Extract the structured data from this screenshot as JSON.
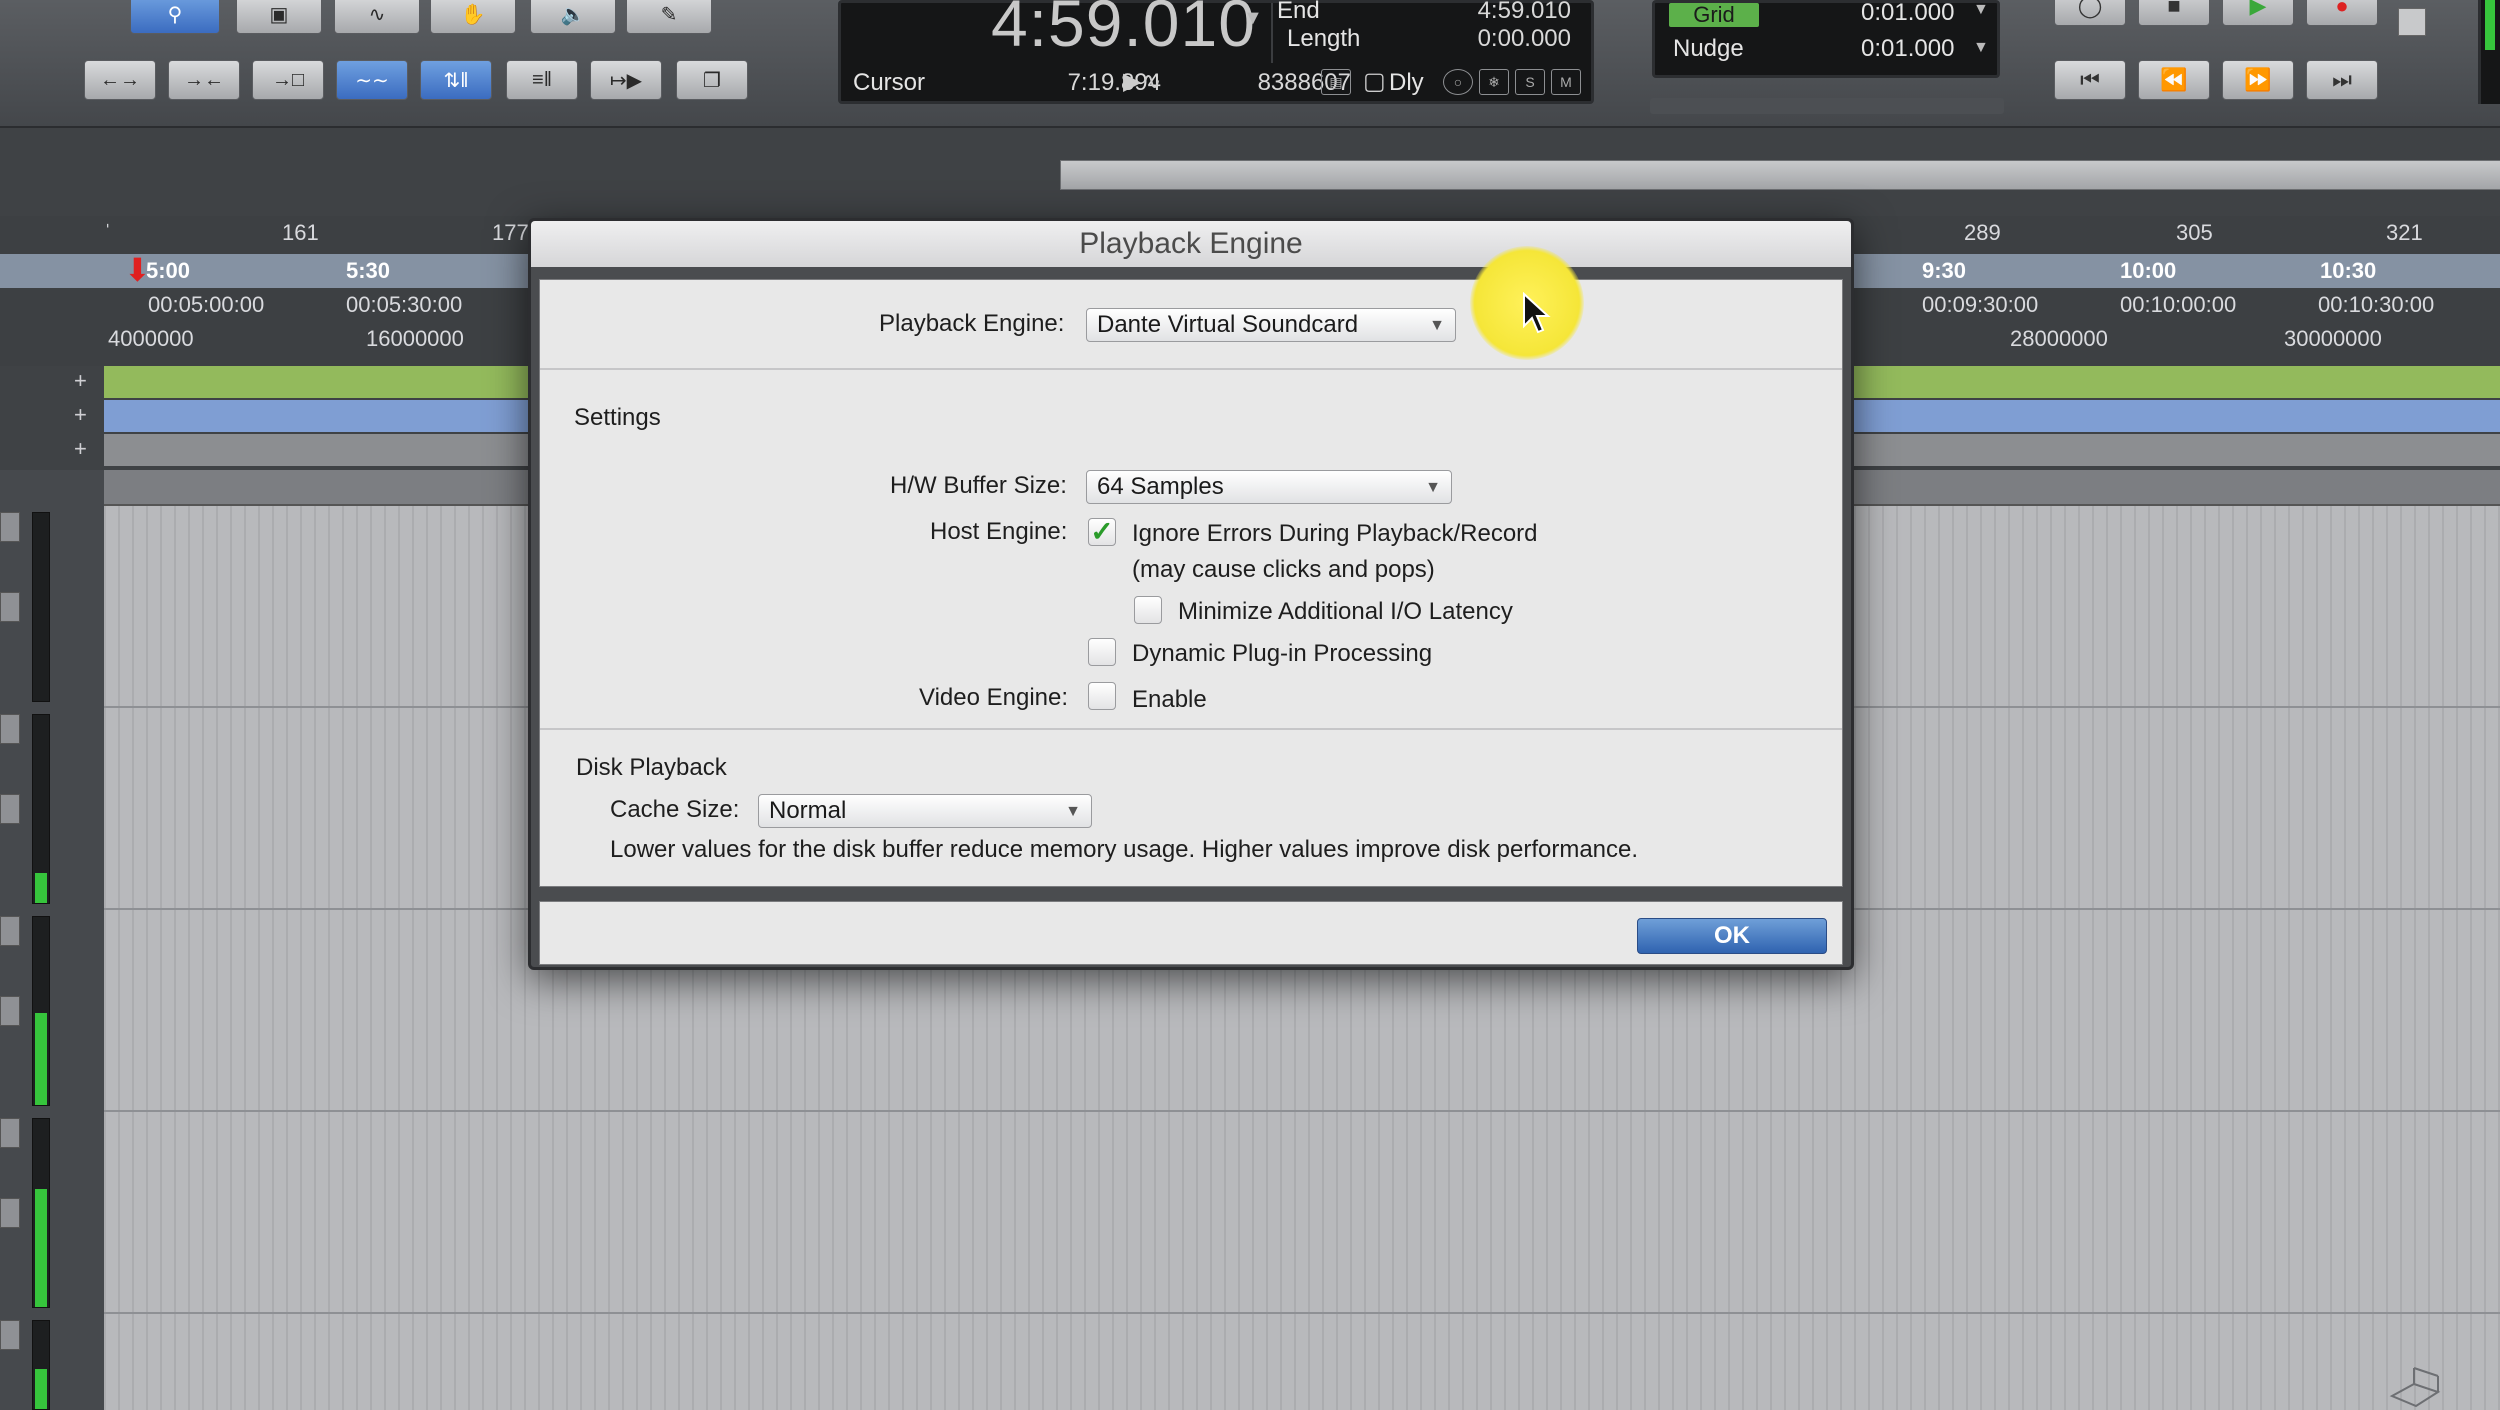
{
  "counter": {
    "main_time": "4:59.010",
    "end_label": "End",
    "end_value": "4:59.010",
    "length_label": "Length",
    "length_value": "0:00.000",
    "cursor_label": "Cursor",
    "cursor_value": "7:19.894",
    "sample_value": "8388607",
    "dly_label": "Dly"
  },
  "grid": {
    "grid_label": "Grid",
    "grid_value": "0:01.000",
    "nudge_label": "Nudge",
    "nudge_value": "0:01.000"
  },
  "ruler": {
    "bars": [
      "161",
      "177",
      "289",
      "305",
      "321"
    ],
    "minsecs": [
      "5:00",
      "5:30",
      "9:30",
      "10:00",
      "10:30"
    ],
    "timecode": [
      "00:05:00:00",
      "00:05:30:00",
      "00:09:30:00",
      "00:10:00:00",
      "00:10:30:00"
    ],
    "samples": [
      "4000000",
      "16000000",
      "28000000",
      "30000000"
    ]
  },
  "dialog": {
    "title": "Playback Engine",
    "playback_engine_label": "Playback Engine:",
    "playback_engine_value": "Dante Virtual Soundcard",
    "settings_title": "Settings",
    "buffer_label": "H/W Buffer Size:",
    "buffer_value": "64 Samples",
    "host_engine_label": "Host Engine:",
    "ignore_errors_label": "Ignore Errors During Playback/Record",
    "ignore_errors_checked": true,
    "ignore_errors_note": "(may cause clicks and pops)",
    "minimize_latency_label": "Minimize Additional I/O Latency",
    "minimize_latency_checked": false,
    "dynamic_plugin_label": "Dynamic Plug-in Processing",
    "dynamic_plugin_checked": false,
    "video_engine_label": "Video Engine:",
    "video_enable_label": "Enable",
    "video_enable_checked": false,
    "disk_title": "Disk Playback",
    "cache_label": "Cache Size:",
    "cache_value": "Normal",
    "cache_note": "Lower values for the disk buffer reduce memory usage.  Higher values improve disk performance.",
    "ok_label": "OK"
  },
  "colors": {
    "track_green": "#93ba5c",
    "track_blue": "#7f9ed3",
    "ok_blue": "#3a6dbd",
    "grid_green": "#5cb04a",
    "check_green": "#2a9b2a"
  }
}
